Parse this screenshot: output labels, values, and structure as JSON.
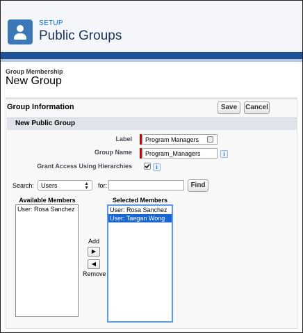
{
  "header": {
    "crumb": "SETUP",
    "title": "Public Groups"
  },
  "page": {
    "subtitle": "Group Membership",
    "title": "New Group"
  },
  "panel": {
    "title": "Group Information",
    "save_label": "Save",
    "cancel_label": "Cancel",
    "section_title": "New Public Group"
  },
  "form": {
    "label_label": "Label",
    "label_value": "Program Managers",
    "group_name_label": "Group Name",
    "group_name_value": "Program_Managers",
    "grant_label": "Grant Access Using Hierarchies",
    "grant_checked": true,
    "info_glyph": "i"
  },
  "search": {
    "search_label": "Search:",
    "select_value": "Users",
    "for_label": "for:",
    "for_value": "",
    "find_label": "Find"
  },
  "available": {
    "title": "Available Members",
    "items": [
      "User: Rosa Sanchez"
    ]
  },
  "selected": {
    "title": "Selected Members",
    "items": [
      "User: Rosa Sanchez",
      "User: Taegan Wong"
    ],
    "highlighted_index": 1
  },
  "mover": {
    "add_label": "Add",
    "remove_label": "Remove",
    "add_glyph": "▶",
    "remove_glyph": "◀"
  },
  "colors": {
    "brand_blue": "#1b5297",
    "icon_blue": "#3c78b5",
    "link_blue": "#0070d2",
    "required_red": "#cc0000",
    "selection_blue": "#1865d8"
  }
}
